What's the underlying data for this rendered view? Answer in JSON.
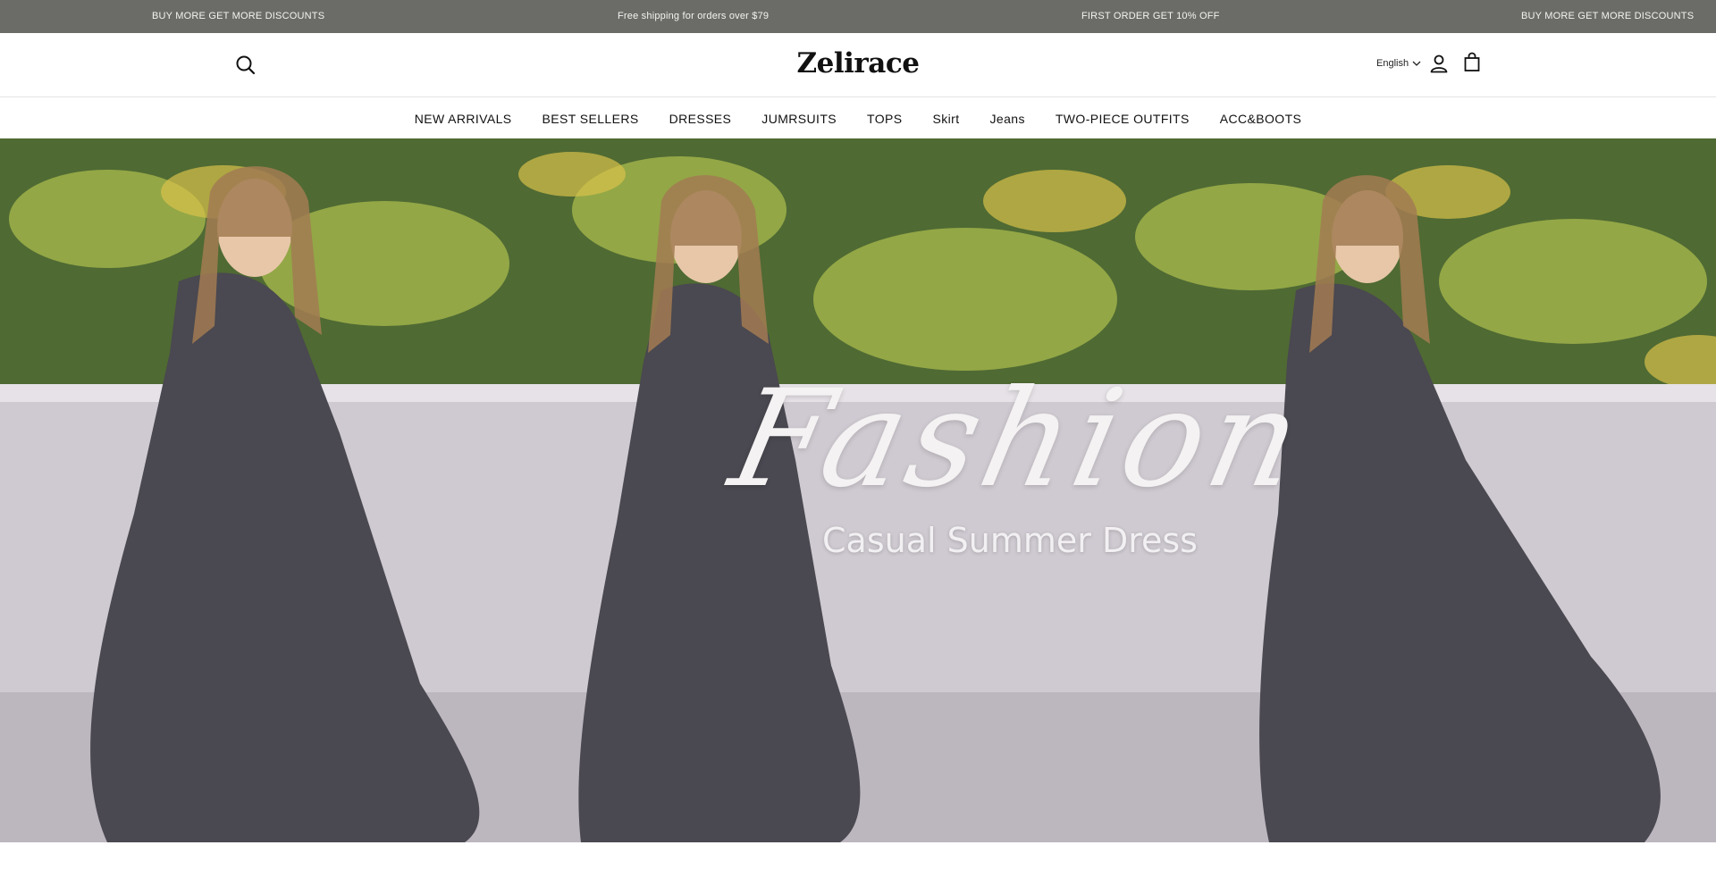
{
  "announcements": [
    "BUY MORE GET MORE DISCOUNTS",
    "Free shipping for orders over $79",
    "FIRST ORDER GET 10% OFF",
    "BUY MORE GET MORE DISCOUNTS"
  ],
  "header": {
    "logo": "Zelirace",
    "language": "English",
    "icons": {
      "search": "search-icon",
      "account": "user-icon",
      "cart": "shopping-bag-icon",
      "language_dropdown": "chevron-down-icon"
    }
  },
  "nav": {
    "items": [
      "NEW ARRIVALS",
      "BEST SELLERS",
      "DRESSES",
      "JUMRSUITS",
      "TOPS",
      "Skirt",
      "Jeans",
      "TWO-PIECE OUTFITS",
      "ACC&BOOTS"
    ]
  },
  "hero": {
    "title": "Fashion",
    "subtitle": "Casual Summer Dress"
  },
  "colors": {
    "announcement_bg": "#6b6b68",
    "announcement_text": "#f3f3f0",
    "text": "#111111",
    "background": "#ffffff"
  }
}
